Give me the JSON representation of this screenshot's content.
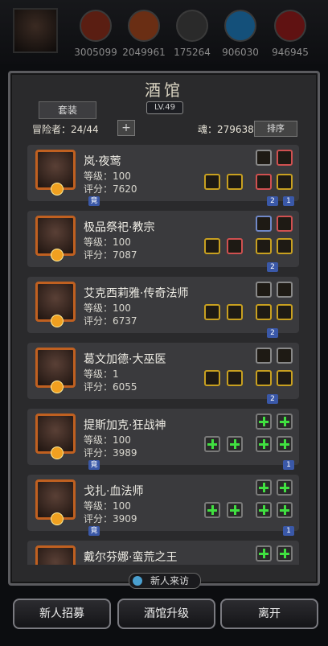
{
  "top_resources": [
    {
      "value": "3005099",
      "color": "#b03a1e"
    },
    {
      "value": "2049961",
      "color": "#c0521e"
    },
    {
      "value": "175264",
      "color": "#4a4a4a"
    },
    {
      "value": "906030",
      "color": "#2a8ad0"
    },
    {
      "value": "946945",
      "color": "#b82020"
    }
  ],
  "tavern": {
    "title": "酒馆",
    "level": "LV.49",
    "suit_button": "套装",
    "adventurers": "冒险者：24/44",
    "add_symbol": "+",
    "soul": "魂：279638",
    "sort_button": "排序"
  },
  "heroes": [
    {
      "name": "岚·夜莺",
      "level": "等级：100",
      "score": "评分：7620",
      "tag_left": "竟",
      "tags_right": [
        "2",
        "1"
      ]
    },
    {
      "name": "极品祭祀·教宗",
      "level": "等级：100",
      "score": "评分：7087",
      "tag_left": "",
      "tags_right": [
        "2"
      ]
    },
    {
      "name": "艾克西莉雅·传奇法师",
      "level": "等级：100",
      "score": "评分：6737",
      "tag_left": "",
      "tags_right": [
        "2"
      ]
    },
    {
      "name": "葛文加德·大巫医",
      "level": "等级：1",
      "score": "评分：6055",
      "tag_left": "",
      "tags_right": [
        "2"
      ]
    },
    {
      "name": "提斯加克·狂战神",
      "level": "等级：100",
      "score": "评分：3989",
      "tag_left": "竟",
      "tags_right": [
        "1"
      ]
    },
    {
      "name": "戈扎·血法师",
      "level": "等级：100",
      "score": "评分：3909",
      "tag_left": "竟",
      "tags_right": [
        "1"
      ]
    },
    {
      "name": "戴尔芬娜·蛮荒之王",
      "level": "",
      "score": "",
      "tag_left": "",
      "tags_right": []
    }
  ],
  "visitor_button": "新人来访",
  "bottom_buttons": {
    "recruit": "新人招募",
    "upgrade": "酒馆升级",
    "leave": "离开"
  }
}
